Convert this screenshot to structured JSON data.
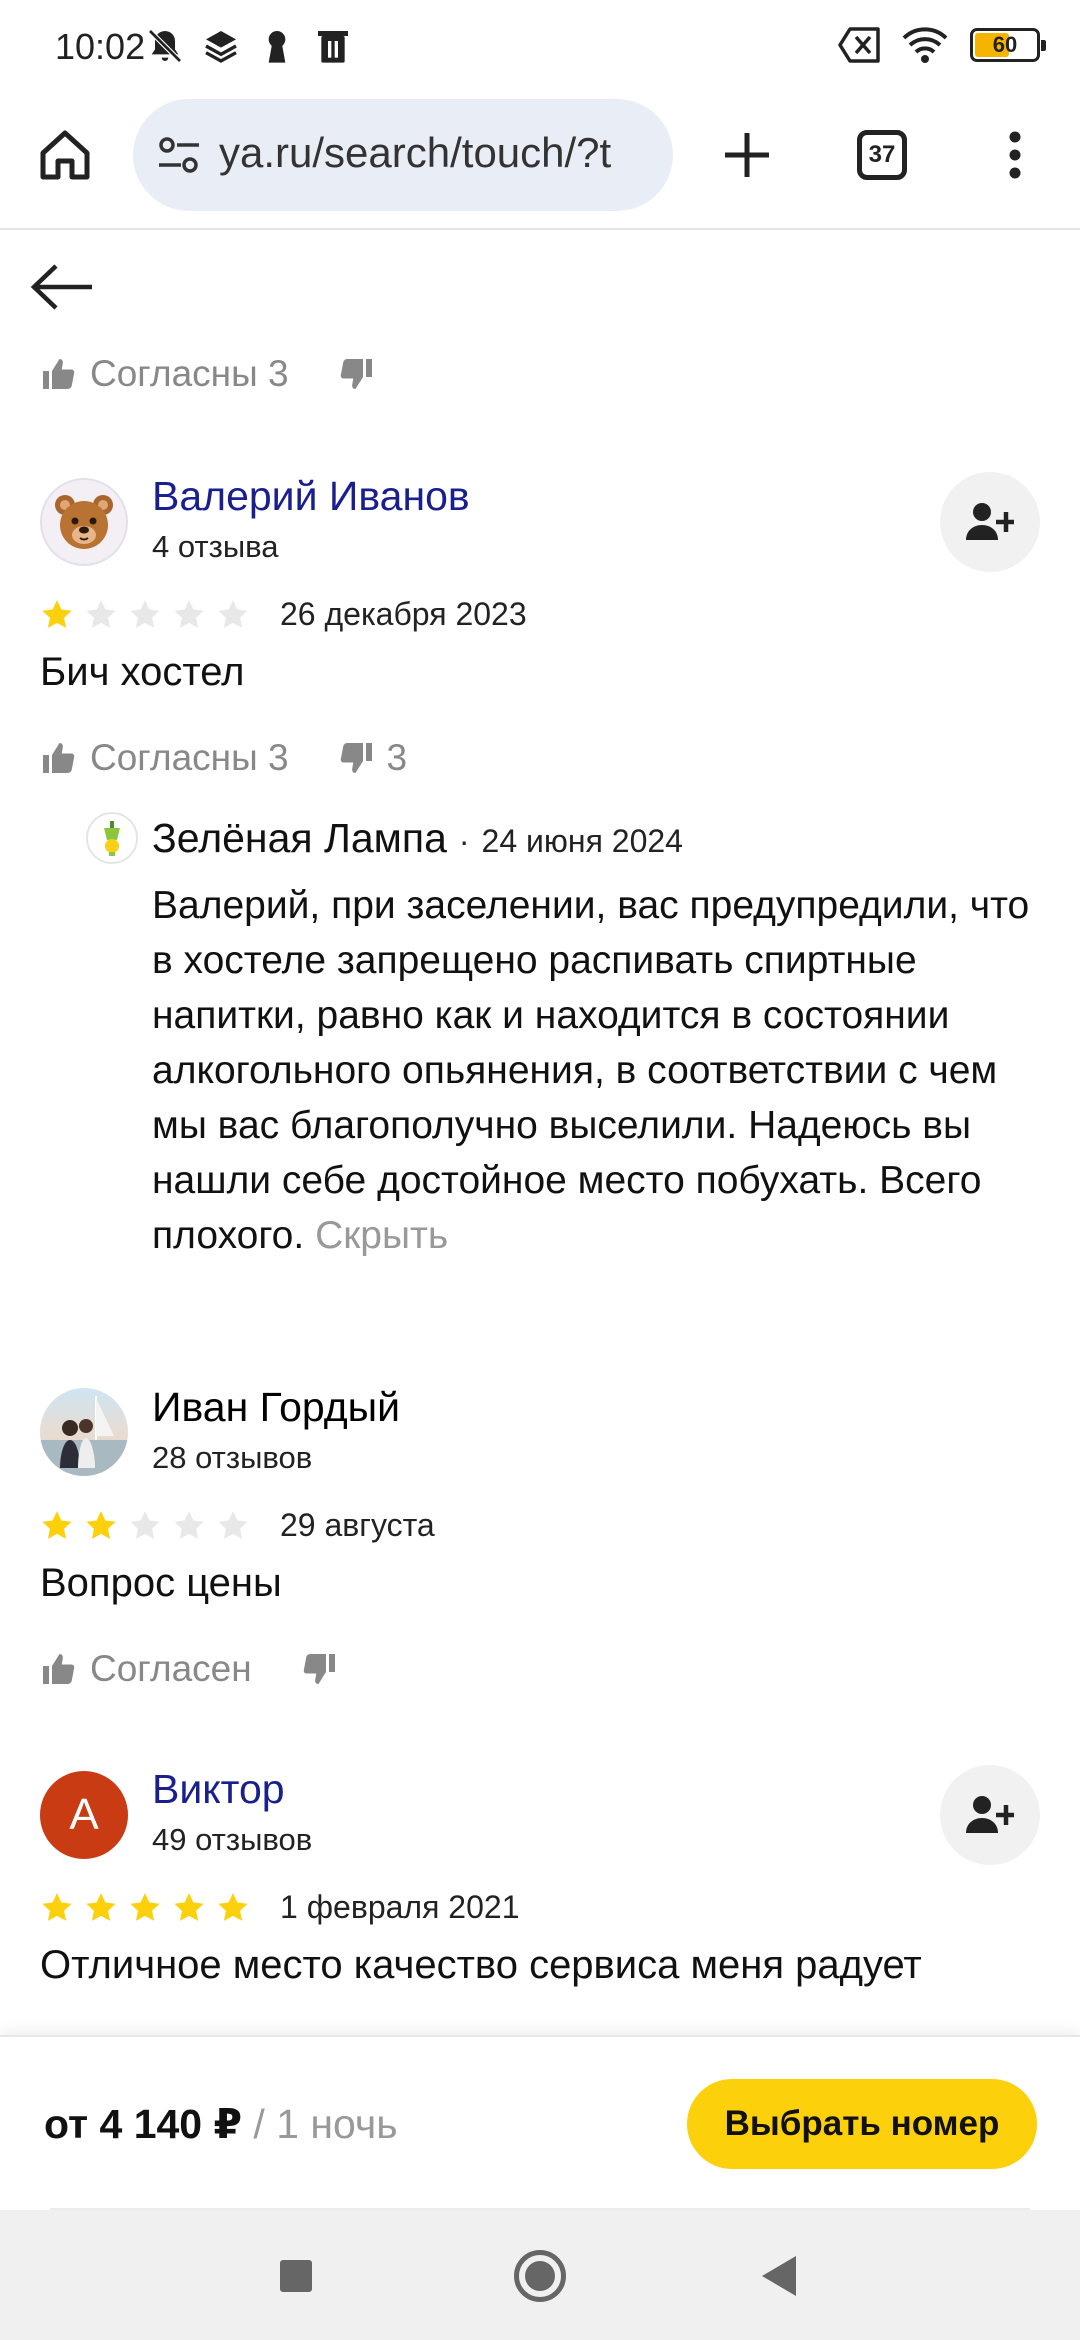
{
  "status_bar": {
    "time": "10:02",
    "battery_level": 60,
    "battery_text": "60",
    "battery_color": "#f5b400",
    "left_icons": [
      "mute-icon",
      "stack-icon",
      "keyhole-icon",
      "trash-icon"
    ],
    "right_icons": [
      "no-sim-icon",
      "wifi-icon",
      "battery-icon"
    ]
  },
  "browser": {
    "url": "ya.ru/search/touch/?t",
    "tab_count": "37",
    "icons": [
      "home-icon",
      "site-settings-icon",
      "new-tab-icon",
      "tabs-icon",
      "more-icon"
    ]
  },
  "reviews": {
    "first_vote": {
      "like_label": "Согласны 3"
    },
    "items": [
      {
        "author": "Валерий Иванов",
        "reviews_count": "4 отзыва",
        "rating": 1,
        "date": "26 декабря 2023",
        "text": "Бич хостел",
        "like_label": "Согласны 3",
        "dislike_count": "3",
        "reply": {
          "author": "Зелёная Лампа",
          "separator": "·",
          "date": "24 июня 2024",
          "text": "Валерий, при заселении, вас предупредили, что в хостеле запрещено распивать спиртные напитки, равно как и находится в состоянии алкогольного опьянения, в соответствии с чем мы вас благополучно выселили. Надеюсь вы нашли себе достойное место побухать. Всего плохого.",
          "hide_label": "Скрыть"
        }
      },
      {
        "author": "Иван Гордый",
        "reviews_count": "28 отзывов",
        "rating": 2,
        "date": "29 августа",
        "text": "Вопрос цены",
        "like_label": "Согласен"
      },
      {
        "author": "Виктор",
        "avatar_letter": "А",
        "reviews_count": "49 отзывов",
        "rating": 5,
        "date": "1 февраля 2021",
        "text": "Отличное место качество сервиса меня радует"
      }
    ]
  },
  "booking": {
    "price": "от 4 140 ₽",
    "unit": " / 1 ночь",
    "button": "Выбрать номер",
    "button_color": "#fcd00a"
  },
  "colors": {
    "link": "#1a1f8f",
    "star_filled": "#fcd00a",
    "star_empty": "#e8e8e8",
    "muted": "#888888"
  }
}
